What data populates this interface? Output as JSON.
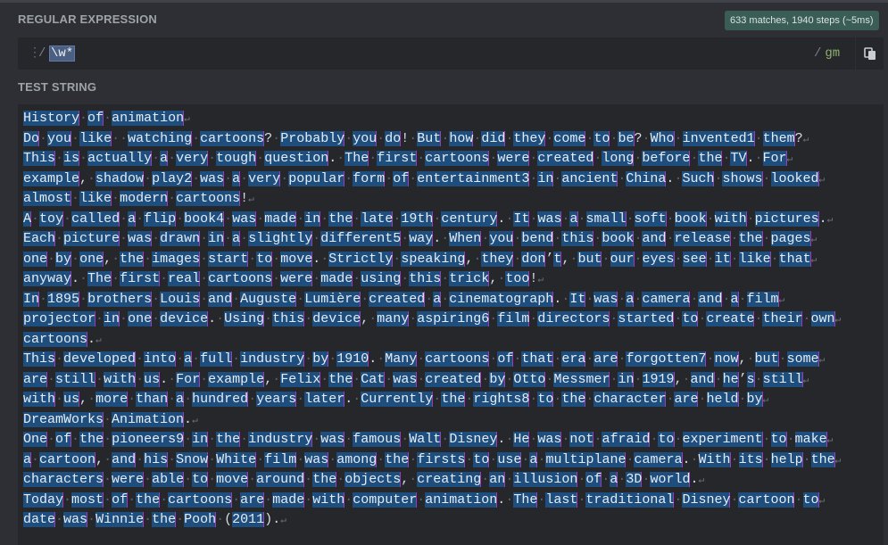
{
  "header": {
    "regex_section_label": "REGULAR EXPRESSION",
    "match_info": "633 matches, 1940 steps (~5ms)"
  },
  "regex": {
    "delimiter": "/",
    "pattern": "\\w*",
    "flags": "gm"
  },
  "icons": {
    "drag": "drag-handle-icon",
    "copy": "copy-icon"
  },
  "test_section_label": "TEST STRING",
  "test_lines": [
    "History of animation",
    "Do you like  watching cartoons? Probably you do! But how did they come to be? Who invented1 them?",
    "This is actually a very tough question. The first cartoons were created long before the TV. For",
    "example, shadow play2 was a very popular form of entertainment3 in ancient China. Such shows looked",
    "almost like modern cartoons!",
    "A toy called a flip book4 was made in the late 19th century. It was a small soft book with pictures.",
    "Each picture was drawn in a slightly different5 way. When you bend this book and release the pages",
    "one by one, the images start to move. Strictly speaking, they don’t, but our eyes see it like that",
    "anyway. The first real cartoons were made using this trick, too!",
    "In 1895 brothers Louis and Auguste Lumière created a cinematograph. It was a camera and a film",
    "projector in one device. Using this device, many aspiring6 film directors started to create their own",
    "cartoons.",
    "This developed into a full industry by 1910. Many cartoons of that era are forgotten7 now, but some",
    "are still with us. For example, Felix the Cat was created by Otto Messmer in 1919, and he’s still",
    "with us, more than a hundred years later. Currently the rights8 to the character are held by",
    "DreamWorks Animation.",
    "One of the pioneers9 in the industry was famous Walt Disney. He was not afraid to experiment to make",
    "a cartoon, and his Snow White film was among the firsts to use a multiplane camera. With its help the",
    "characters were able to move around the objects, creating an illusion of a 3D world.",
    "Today most of the cartoons are made with computer animation. The last traditional Disney cartoon to",
    "date was Winnie the Pooh (2011)."
  ]
}
